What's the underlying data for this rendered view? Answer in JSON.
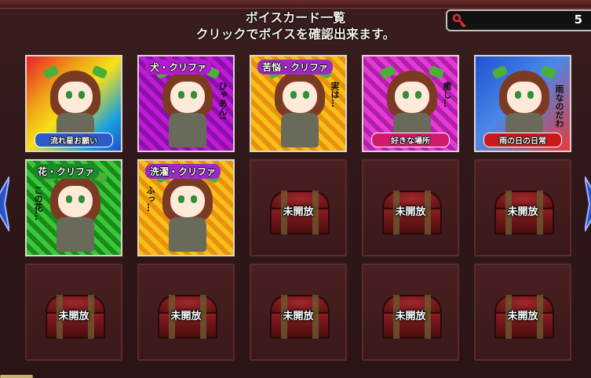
{
  "header": {
    "title_line1": "ボイスカード一覧",
    "title_line2": "クリックでボイスを確認出来ます。"
  },
  "counter": {
    "icon": "key-icon",
    "value": "5"
  },
  "cards": [
    {
      "banner": "流れ星お願い",
      "banner_color": "#2a5cc8",
      "bg": "rainbow",
      "side": ""
    },
    {
      "banner": "犬・クリファ",
      "banner_color": "#b21ad0",
      "bg": "purple",
      "side": "ひゃあん!"
    },
    {
      "banner": "苦悩・クリファ",
      "banner_color": "#9a2ac8",
      "bg": "gold",
      "side": "実は…"
    },
    {
      "banner": "好きな場所",
      "banner_color": "#d01a6a",
      "bg": "magenta",
      "side": "癒し…"
    },
    {
      "banner": "雨の日の日常",
      "banner_color": "#c81a1a",
      "bg": "bluered",
      "side": "雨なのだわ"
    },
    {
      "banner": "花・クリファ",
      "banner_color": "#1a8a2a",
      "bg": "green",
      "side": "この花…"
    },
    {
      "banner": "洗濯・クリファ",
      "banner_color": "#9a2ac8",
      "bg": "gold",
      "side": "ふっ…"
    }
  ],
  "locked_label": "未開放",
  "locked_count": 8,
  "colors": {
    "background": "#2f1719",
    "locked_tile": "#3a1819",
    "nav_arrow": "#2a52c8"
  }
}
